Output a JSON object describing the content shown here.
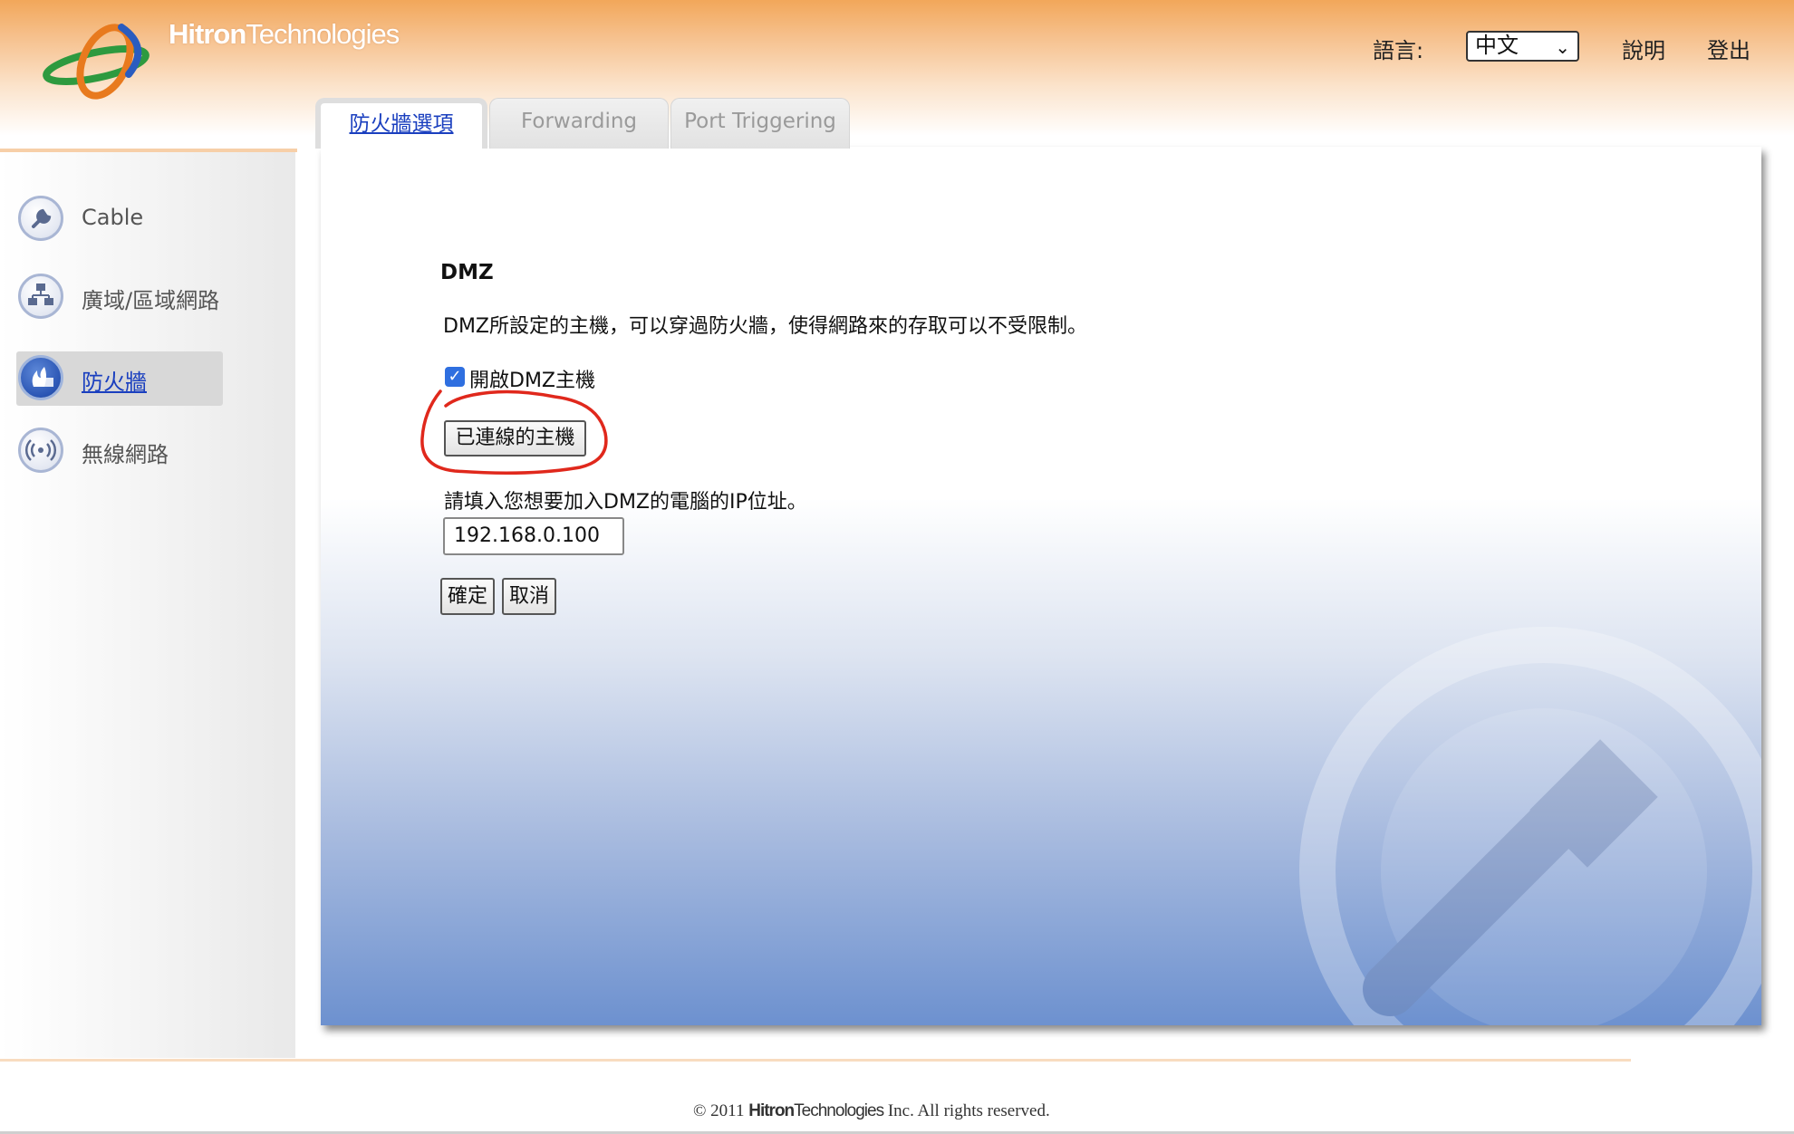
{
  "header": {
    "brand": "Hitron",
    "brand_suffix": "Technologies",
    "lang_label": "語言:",
    "lang_selected": "中文",
    "help_link": "說明",
    "logout_link": "登出"
  },
  "tabs": [
    {
      "label": "防火牆選項",
      "active": true
    },
    {
      "label": "Forwarding",
      "active": false
    },
    {
      "label": "Port Triggering",
      "active": false
    }
  ],
  "sidebar": {
    "items": [
      {
        "label": "Cable",
        "icon": "wrench-icon"
      },
      {
        "label": "廣域/區域網路",
        "icon": "network-icon"
      },
      {
        "label": "防火牆",
        "icon": "firewall-icon",
        "active": true
      },
      {
        "label": "無線網路",
        "icon": "wireless-icon"
      }
    ]
  },
  "main": {
    "title": "DMZ",
    "description": "DMZ所設定的主機，可以穿過防火牆，使得網路來的存取可以不受限制。",
    "enable_checkbox_label": "開啟DMZ主機",
    "enable_checked": true,
    "connected_hosts_button": "已連線的主機",
    "ip_prompt": "請填入您想要加入DMZ的電腦的IP位址。",
    "ip_value": "192.168.0.100",
    "confirm_button": "確定",
    "cancel_button": "取消"
  },
  "footer": {
    "copyright": "© 2011",
    "brand": "Hitron",
    "brand_suffix": "Technologies",
    "rest": "Inc.  All rights reserved."
  },
  "colors": {
    "accent_blue": "#1a3fbf",
    "header_orange": "#f2a75a",
    "annotation_red": "#e0281c"
  }
}
